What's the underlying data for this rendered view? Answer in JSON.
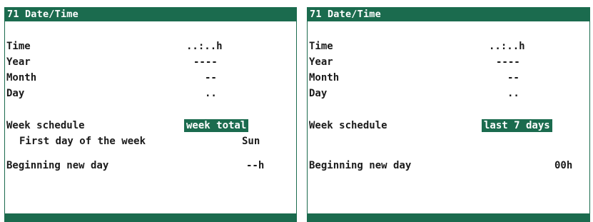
{
  "left": {
    "title": "71 Date/Time",
    "time_label": "Time",
    "time_value": "..:..h",
    "year_label": "Year",
    "year_value": "----",
    "month_label": "Month",
    "month_value": "--",
    "day_label": "Day",
    "day_value": "..",
    "week_schedule_label": "Week schedule",
    "week_schedule_value": "week total",
    "first_day_label": "First day of the week",
    "first_day_value": "Sun",
    "beginning_label": "Beginning new day",
    "beginning_value": "--h"
  },
  "right": {
    "title": "71 Date/Time",
    "time_label": "Time",
    "time_value": "..:..h",
    "year_label": "Year",
    "year_value": "----",
    "month_label": "Month",
    "month_value": "--",
    "day_label": "Day",
    "day_value": "..",
    "week_schedule_label": "Week schedule",
    "week_schedule_value": "last 7 days",
    "beginning_label": "Beginning new day",
    "beginning_value": "00h"
  },
  "colors": {
    "accent": "#1b6b4e",
    "background": "#ffffff",
    "text": "#1a1a1a"
  }
}
